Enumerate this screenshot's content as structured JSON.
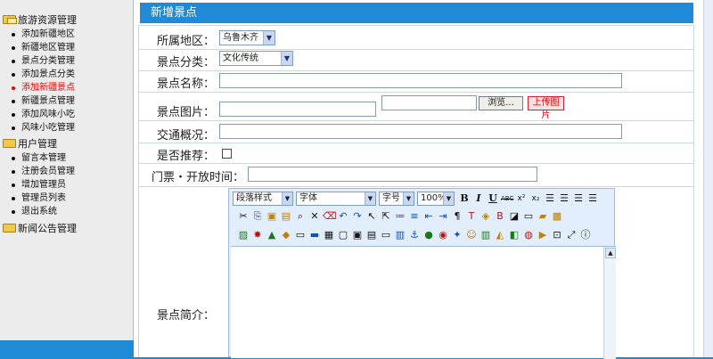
{
  "sidebar": {
    "groups": [
      {
        "label": "旅游资源管理",
        "items": [
          "添加新疆地区",
          "新疆地区管理",
          "景点分类管理",
          "添加景点分类",
          "添加新疆景点",
          "新疆景点管理",
          "添加风味小吃",
          "风味小吃管理"
        ]
      },
      {
        "label": "用户管理",
        "items": [
          "留言本管理",
          "注册会员管理",
          "增加管理员",
          "管理员列表",
          "退出系统"
        ]
      },
      {
        "label": "新闻公告管理",
        "items": []
      }
    ],
    "active_item": "添加新疆景点"
  },
  "panel": {
    "title": "新增景点"
  },
  "form": {
    "region_label": "所属地区：",
    "region_value": "乌鲁木齐",
    "category_label": "景点分类：",
    "category_value": "文化传统",
    "name_label": "景点名称：",
    "image_label": "景点图片：",
    "browse_button": "浏览...",
    "upload_button": "上传图片",
    "traffic_label": "交通概况：",
    "recommend_label": "是否推荐：",
    "ticket_label": "门票・开放时间：",
    "intro_label": "景点简介："
  },
  "editor": {
    "paragraph_style": "段落样式",
    "font_family": "字体",
    "font_size": "字号",
    "zoom": "100%",
    "icons_row1": [
      "bold-icon",
      "italic-icon",
      "underline-icon",
      "strikethrough-icon",
      "superscript-icon",
      "subscript-icon",
      "align-left-icon",
      "align-center-icon",
      "align-right-icon",
      "align-justify-icon"
    ],
    "icons_row2": [
      "cut-icon",
      "copy-icon",
      "paste-icon",
      "paste-text-icon",
      "find-icon",
      "delete-icon",
      "eraser-icon",
      "undo-icon",
      "redo-icon",
      "select-icon",
      "pointer-icon",
      "ordered-list-icon",
      "unordered-list-icon",
      "outdent-icon",
      "indent-icon",
      "paragraph-icon",
      "text-color-icon",
      "highlight-icon",
      "bgcolor-icon",
      "fill-icon",
      "frame-icon",
      "comment-icon",
      "copy-format-icon"
    ],
    "icons_row3": [
      "image-icon",
      "flash-icon",
      "media-icon",
      "special-icon",
      "table-icon",
      "form-icon",
      "grid-icon",
      "page-icon",
      "template-icon",
      "hr-icon",
      "field-icon",
      "textbox-icon",
      "anchor-icon",
      "link-icon",
      "unlink-icon",
      "emotion-icon",
      "smiley-icon",
      "chart-icon",
      "excel-icon",
      "art-icon",
      "spell-icon",
      "preview-icon",
      "export-icon",
      "fullscreen-icon",
      "info-icon"
    ]
  }
}
